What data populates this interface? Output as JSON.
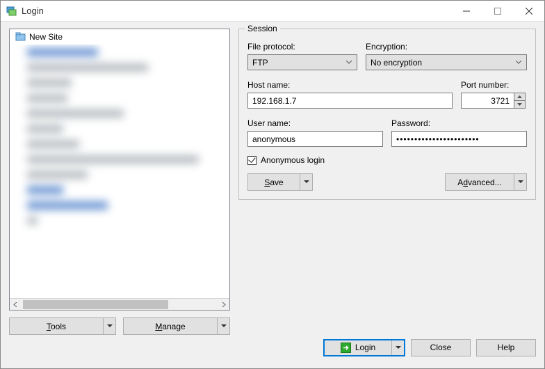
{
  "window": {
    "title": "Login"
  },
  "tree": {
    "new_site_label": "New Site"
  },
  "session": {
    "legend": "Session",
    "file_protocol_label": "File protocol:",
    "file_protocol_value": "FTP",
    "encryption_label": "Encryption:",
    "encryption_value": "No encryption",
    "host_name_label": "Host name:",
    "host_name_value": "192.168.1.7",
    "port_number_label": "Port number:",
    "port_number_value": "3721",
    "user_name_label": "User name:",
    "user_name_value": "anonymous",
    "password_label": "Password:",
    "password_masked": "•••••••••••••••••••••••",
    "anonymous_label": "Anonymous login",
    "anonymous_checked": true,
    "save_label": "Save",
    "advanced_label": "Advanced..."
  },
  "left_buttons": {
    "tools": "Tools",
    "manage": "Manage"
  },
  "footer": {
    "login": "Login",
    "close": "Close",
    "help": "Help"
  }
}
